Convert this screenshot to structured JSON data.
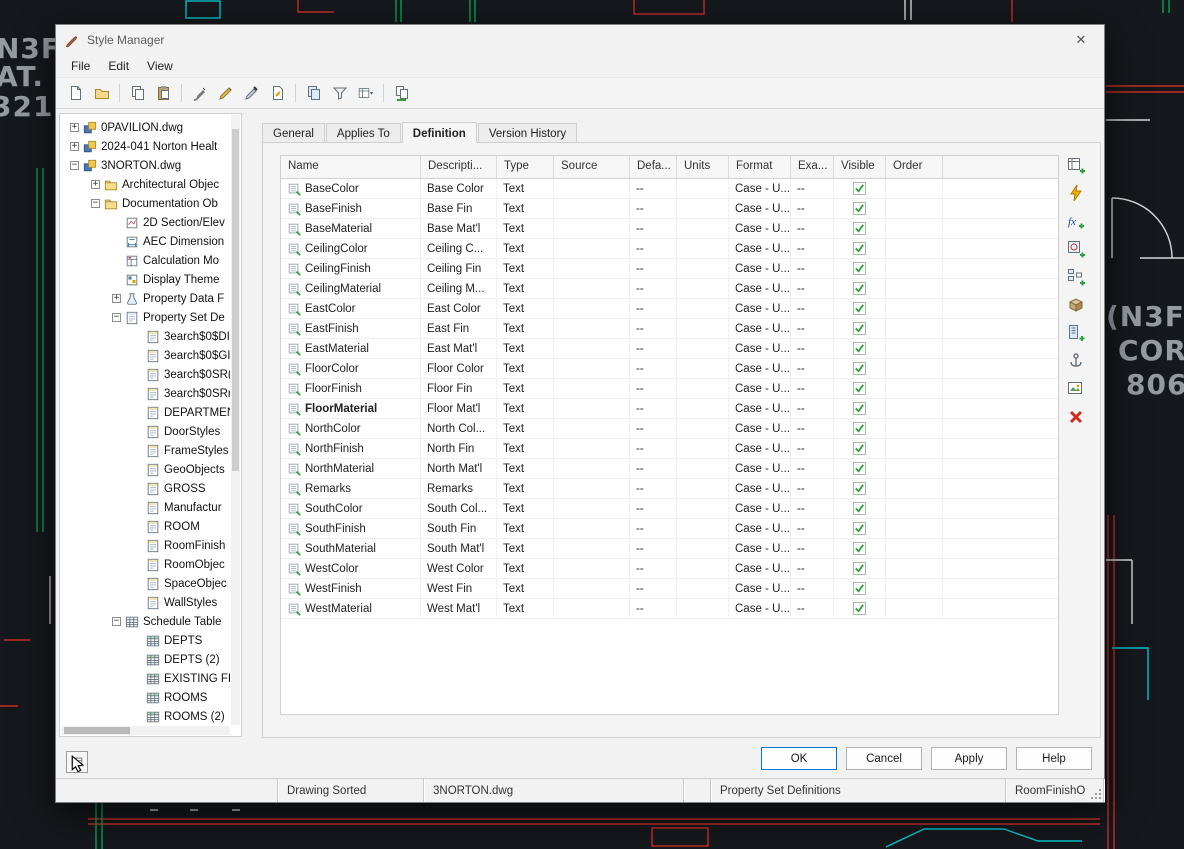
{
  "background": {
    "labels": [
      {
        "text": "N3F"
      },
      {
        "text": "AT."
      },
      {
        "text": "321"
      },
      {
        "text": "(N3F"
      },
      {
        "text": "COR"
      },
      {
        "text": "806"
      }
    ]
  },
  "window": {
    "title": "Style Manager",
    "close_glyph": "✕"
  },
  "menu": {
    "items": [
      "File",
      "Edit",
      "View"
    ]
  },
  "toolbar": {
    "items": [
      {
        "icon": "newdwg"
      },
      {
        "icon": "opendwg"
      },
      {
        "sep": true
      },
      {
        "icon": "copy"
      },
      {
        "icon": "paste"
      },
      {
        "sep": true
      },
      {
        "icon": "editstyle"
      },
      {
        "icon": "newstyle"
      },
      {
        "icon": "setfrom"
      },
      {
        "icon": "purge"
      },
      {
        "sep": true
      },
      {
        "icon": "copystyles"
      },
      {
        "icon": "filter"
      },
      {
        "icon": "listview"
      },
      {
        "sep": true
      },
      {
        "icon": "sync"
      }
    ]
  },
  "tree": {
    "items": [
      {
        "indent": 0,
        "expand": "plus",
        "icon": "dwg",
        "label": "0PAVILION.dwg"
      },
      {
        "indent": 0,
        "expand": "plus",
        "icon": "dwg",
        "label": "2024-041 Norton Healt"
      },
      {
        "indent": 0,
        "expand": "minus",
        "icon": "dwg",
        "label": "3NORTON.dwg"
      },
      {
        "indent": 1,
        "expand": "plus",
        "icon": "folder",
        "label": "Architectural Objec"
      },
      {
        "indent": 1,
        "expand": "minus",
        "icon": "folder",
        "label": "Documentation Ob"
      },
      {
        "indent": 2,
        "expand": "none",
        "icon": "section",
        "label": "2D Section/Elev"
      },
      {
        "indent": 2,
        "expand": "none",
        "icon": "dim",
        "label": "AEC Dimension"
      },
      {
        "indent": 2,
        "expand": "none",
        "icon": "calc",
        "label": "Calculation Mo"
      },
      {
        "indent": 2,
        "expand": "none",
        "icon": "theme",
        "label": "Display Theme"
      },
      {
        "indent": 2,
        "expand": "plus",
        "icon": "propdata",
        "label": "Property Data F"
      },
      {
        "indent": 2,
        "expand": "minus",
        "icon": "propset",
        "label": "Property Set De"
      },
      {
        "indent": 3,
        "expand": "none",
        "icon": "card",
        "label": "3earch$0$DI"
      },
      {
        "indent": 3,
        "expand": "none",
        "icon": "card",
        "label": "3earch$0$GI"
      },
      {
        "indent": 3,
        "expand": "none",
        "icon": "card",
        "label": "3earch$0SR("
      },
      {
        "indent": 3,
        "expand": "none",
        "icon": "card",
        "label": "3earch$0SRr"
      },
      {
        "indent": 3,
        "expand": "none",
        "icon": "card",
        "label": "DEPARTMEN"
      },
      {
        "indent": 3,
        "expand": "none",
        "icon": "card",
        "label": "DoorStyles"
      },
      {
        "indent": 3,
        "expand": "none",
        "icon": "card",
        "label": "FrameStyles"
      },
      {
        "indent": 3,
        "expand": "none",
        "icon": "card",
        "label": "GeoObjects"
      },
      {
        "indent": 3,
        "expand": "none",
        "icon": "card",
        "label": "GROSS"
      },
      {
        "indent": 3,
        "expand": "none",
        "icon": "card",
        "label": "Manufactur"
      },
      {
        "indent": 3,
        "expand": "none",
        "icon": "card",
        "label": "ROOM"
      },
      {
        "indent": 3,
        "expand": "none",
        "icon": "card",
        "label": "RoomFinish"
      },
      {
        "indent": 3,
        "expand": "none",
        "icon": "card",
        "label": "RoomObjec"
      },
      {
        "indent": 3,
        "expand": "none",
        "icon": "card",
        "label": "SpaceObjec"
      },
      {
        "indent": 3,
        "expand": "none",
        "icon": "card",
        "label": "WallStyles"
      },
      {
        "indent": 2,
        "expand": "minus",
        "icon": "schedtab",
        "label": "Schedule Table"
      },
      {
        "indent": 3,
        "expand": "none",
        "icon": "grid",
        "label": "DEPTS"
      },
      {
        "indent": 3,
        "expand": "none",
        "icon": "grid",
        "label": "DEPTS (2)"
      },
      {
        "indent": 3,
        "expand": "none",
        "icon": "grid",
        "label": "EXISTING FII"
      },
      {
        "indent": 3,
        "expand": "none",
        "icon": "grid",
        "label": "ROOMS"
      },
      {
        "indent": 3,
        "expand": "none",
        "icon": "grid",
        "label": "ROOMS (2)"
      }
    ]
  },
  "tabs": {
    "items": [
      {
        "label": "General"
      },
      {
        "label": "Applies To"
      },
      {
        "label": "Definition",
        "active": true
      },
      {
        "label": "Version History"
      }
    ]
  },
  "table": {
    "columns": [
      "Name",
      "Descripti...",
      "Type",
      "Source",
      "Defa...",
      "Units",
      "Format",
      "Exa...",
      "Visible",
      "Order"
    ],
    "rows": [
      {
        "name": "BaseColor",
        "description": "Base Color",
        "type": "Text",
        "source": "",
        "default": "--",
        "units": "",
        "format": "Case - U...",
        "example": "--",
        "visible": true,
        "order": ""
      },
      {
        "name": "BaseFinish",
        "description": "Base Fin",
        "type": "Text",
        "source": "",
        "default": "--",
        "units": "",
        "format": "Case - U...",
        "example": "--",
        "visible": true,
        "order": ""
      },
      {
        "name": "BaseMaterial",
        "description": "Base Mat'l",
        "type": "Text",
        "source": "",
        "default": "--",
        "units": "",
        "format": "Case - U...",
        "example": "--",
        "visible": true,
        "order": ""
      },
      {
        "name": "CeilingColor",
        "description": "Ceiling C...",
        "type": "Text",
        "source": "",
        "default": "--",
        "units": "",
        "format": "Case - U...",
        "example": "--",
        "visible": true,
        "order": ""
      },
      {
        "name": "CeilingFinish",
        "description": "Ceiling Fin",
        "type": "Text",
        "source": "",
        "default": "--",
        "units": "",
        "format": "Case - U...",
        "example": "--",
        "visible": true,
        "order": ""
      },
      {
        "name": "CeilingMaterial",
        "description": "Ceiling M...",
        "type": "Text",
        "source": "",
        "default": "--",
        "units": "",
        "format": "Case - U...",
        "example": "--",
        "visible": true,
        "order": ""
      },
      {
        "name": "EastColor",
        "description": "East Color",
        "type": "Text",
        "source": "",
        "default": "--",
        "units": "",
        "format": "Case - U...",
        "example": "--",
        "visible": true,
        "order": ""
      },
      {
        "name": "EastFinish",
        "description": "East Fin",
        "type": "Text",
        "source": "",
        "default": "--",
        "units": "",
        "format": "Case - U...",
        "example": "--",
        "visible": true,
        "order": ""
      },
      {
        "name": "EastMaterial",
        "description": "East Mat'l",
        "type": "Text",
        "source": "",
        "default": "--",
        "units": "",
        "format": "Case - U...",
        "example": "--",
        "visible": true,
        "order": ""
      },
      {
        "name": "FloorColor",
        "description": "Floor Color",
        "type": "Text",
        "source": "",
        "default": "--",
        "units": "",
        "format": "Case - U...",
        "example": "--",
        "visible": true,
        "order": ""
      },
      {
        "name": "FloorFinish",
        "description": "Floor Fin",
        "type": "Text",
        "source": "",
        "default": "--",
        "units": "",
        "format": "Case - U...",
        "example": "--",
        "visible": true,
        "order": ""
      },
      {
        "name": "FloorMaterial",
        "description": "Floor Mat'l",
        "type": "Text",
        "source": "",
        "default": "--",
        "units": "",
        "format": "Case - U...",
        "example": "--",
        "visible": true,
        "order": "",
        "selected": true
      },
      {
        "name": "NorthColor",
        "description": "North Col...",
        "type": "Text",
        "source": "",
        "default": "--",
        "units": "",
        "format": "Case - U...",
        "example": "--",
        "visible": true,
        "order": ""
      },
      {
        "name": "NorthFinish",
        "description": "North Fin",
        "type": "Text",
        "source": "",
        "default": "--",
        "units": "",
        "format": "Case - U...",
        "example": "--",
        "visible": true,
        "order": ""
      },
      {
        "name": "NorthMaterial",
        "description": "North Mat'l",
        "type": "Text",
        "source": "",
        "default": "--",
        "units": "",
        "format": "Case - U...",
        "example": "--",
        "visible": true,
        "order": ""
      },
      {
        "name": "Remarks",
        "description": "Remarks",
        "type": "Text",
        "source": "",
        "default": "--",
        "units": "",
        "format": "Case - U...",
        "example": "--",
        "visible": true,
        "order": ""
      },
      {
        "name": "SouthColor",
        "description": "South Col...",
        "type": "Text",
        "source": "",
        "default": "--",
        "units": "",
        "format": "Case - U...",
        "example": "--",
        "visible": true,
        "order": ""
      },
      {
        "name": "SouthFinish",
        "description": "South Fin",
        "type": "Text",
        "source": "",
        "default": "--",
        "units": "",
        "format": "Case - U...",
        "example": "--",
        "visible": true,
        "order": ""
      },
      {
        "name": "SouthMaterial",
        "description": "South Mat'l",
        "type": "Text",
        "source": "",
        "default": "--",
        "units": "",
        "format": "Case - U...",
        "example": "--",
        "visible": true,
        "order": ""
      },
      {
        "name": "WestColor",
        "description": "West Color",
        "type": "Text",
        "source": "",
        "default": "--",
        "units": "",
        "format": "Case - U...",
        "example": "--",
        "visible": true,
        "order": ""
      },
      {
        "name": "WestFinish",
        "description": "West Fin",
        "type": "Text",
        "source": "",
        "default": "--",
        "units": "",
        "format": "Case - U...",
        "example": "--",
        "visible": true,
        "order": ""
      },
      {
        "name": "WestMaterial",
        "description": "West Mat'l",
        "type": "Text",
        "source": "",
        "default": "--",
        "units": "",
        "format": "Case - U...",
        "example": "--",
        "visible": true,
        "order": ""
      }
    ]
  },
  "side_toolbar": {
    "items": [
      {
        "name": "add-manual-property",
        "icon": "addmanual"
      },
      {
        "name": "add-automatic-property",
        "icon": "bolt"
      },
      {
        "name": "add-formula-property",
        "icon": "fx"
      },
      {
        "name": "add-location-property",
        "icon": "location"
      },
      {
        "name": "add-classification-property",
        "icon": "classif"
      },
      {
        "name": "add-material-property",
        "icon": "material"
      },
      {
        "name": "add-project-property",
        "icon": "project"
      },
      {
        "name": "add-anchor-property",
        "icon": "anchor"
      },
      {
        "name": "add-graphic-property",
        "icon": "graphic"
      },
      {
        "name": "remove-property",
        "icon": "redx"
      }
    ]
  },
  "buttons": {
    "items": [
      {
        "label": "OK",
        "default": true
      },
      {
        "label": "Cancel"
      },
      {
        "label": "Apply"
      },
      {
        "label": "Help"
      }
    ]
  },
  "statusbar": {
    "segments": [
      "",
      "Drawing Sorted",
      "3NORTON.dwg",
      "",
      "Property Set Definitions",
      "RoomFinishO"
    ]
  },
  "colors": {
    "accent": "#0078d7",
    "check_green": "#2f9e3f",
    "delete_red": "#cf2b20",
    "cad_red": "#c62f2a",
    "cad_green": "#00a550",
    "cad_cyan": "#00c2cf"
  }
}
